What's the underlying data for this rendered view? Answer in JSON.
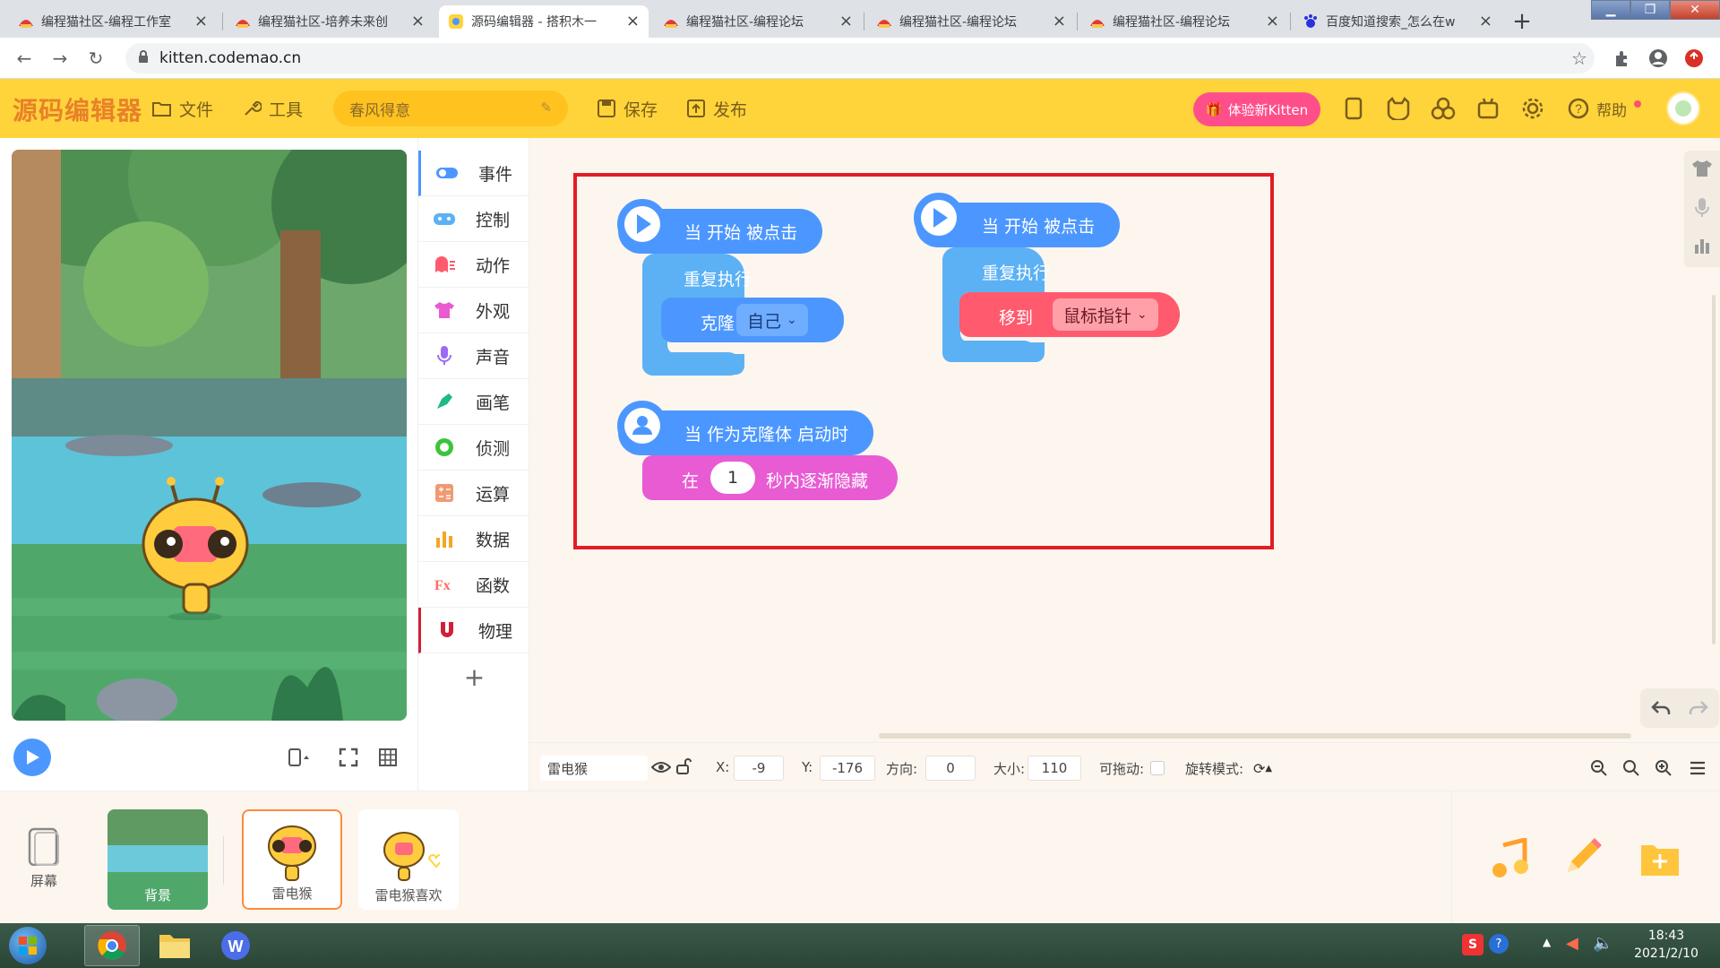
{
  "browser": {
    "tabs": [
      {
        "title": "编程猫社区-编程工作室",
        "active": false
      },
      {
        "title": "编程猫社区-培养未来创",
        "active": false
      },
      {
        "title": "源码编辑器 - 搭积木一",
        "active": true
      },
      {
        "title": "编程猫社区-编程论坛",
        "active": false
      },
      {
        "title": "编程猫社区-编程论坛",
        "active": false
      },
      {
        "title": "编程猫社区-编程论坛",
        "active": false
      },
      {
        "title": "百度知道搜索_怎么在w",
        "active": false
      }
    ],
    "url": "kitten.codemao.cn"
  },
  "app": {
    "logo": "源码编辑器",
    "file_label": "文件",
    "tools_label": "工具",
    "work_name": "春风得意",
    "save_label": "保存",
    "publish_label": "发布",
    "try_new_label": "体验新Kitten",
    "help_label": "帮助"
  },
  "categories": [
    {
      "label": "事件",
      "color": "#4c97ff"
    },
    {
      "label": "控制",
      "color": "#5cb1f5"
    },
    {
      "label": "动作",
      "color": "#ff5a6e"
    },
    {
      "label": "外观",
      "color": "#e85bd3"
    },
    {
      "label": "声音",
      "color": "#9b6bf5"
    },
    {
      "label": "画笔",
      "color": "#1fb98a"
    },
    {
      "label": "侦测",
      "color": "#3cc43c"
    },
    {
      "label": "运算",
      "color": "#f09a74"
    },
    {
      "label": "数据",
      "color": "#f5a623"
    },
    {
      "label": "函数",
      "color": "#ff6b5f"
    },
    {
      "label": "物理",
      "color": "#d0203a"
    }
  ],
  "add_category": "+",
  "scripts": {
    "s1": {
      "hat": "当 开始 被点击",
      "repeat": "重复执行",
      "clone": "克隆",
      "clone_target": "自己"
    },
    "s2": {
      "hat": "当 开始 被点击",
      "repeat": "重复执行",
      "move": "移到",
      "move_target": "鼠标指针"
    },
    "s3": {
      "hat": "当 作为克隆体 启动时",
      "prefix": "在",
      "seconds": "1",
      "suffix": "秒内逐渐隐藏"
    }
  },
  "props": {
    "sprite_name": "雷电猴",
    "x_label": "X:",
    "x": "-9",
    "y_label": "Y:",
    "y": "-176",
    "dir_label": "方向:",
    "dir": "0",
    "size_label": "大小:",
    "size": "110",
    "drag_label": "可拖动:",
    "rot_label": "旋转模式:"
  },
  "spritebar": {
    "screen_label": "屏幕",
    "sprites": [
      "背景",
      "雷电猴",
      "雷电猴喜欢"
    ]
  },
  "taskbar": {
    "time": "18:43",
    "date": "2021/2/10"
  },
  "colors": {
    "header": "#ffd43b",
    "event_blue": "#4c97ff",
    "control_blue": "#5cb1f5",
    "motion_red": "#ff5a6e",
    "looks_pink": "#e85bd3",
    "highlight_red": "#e11d25"
  }
}
